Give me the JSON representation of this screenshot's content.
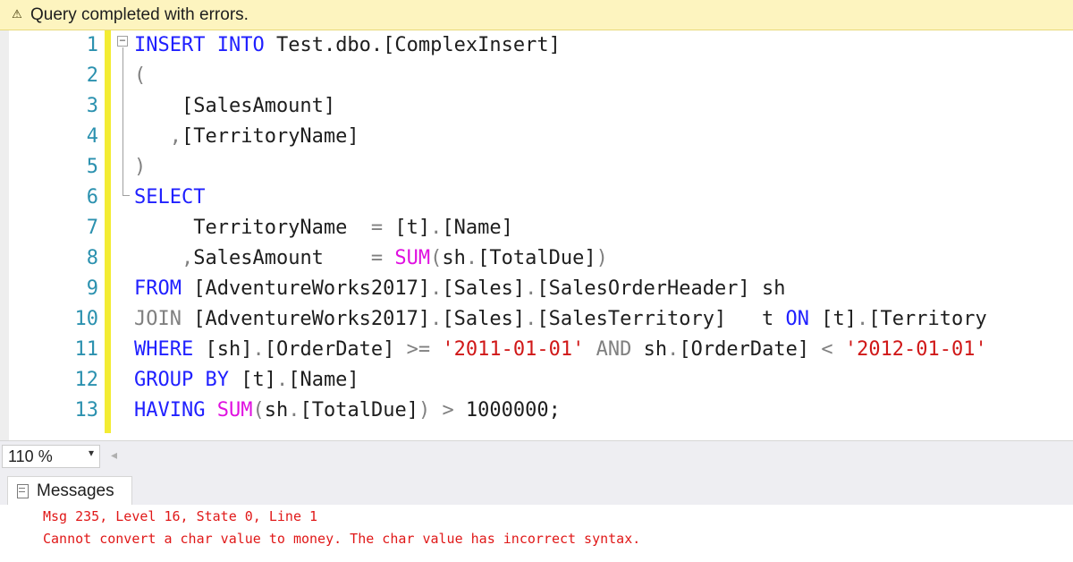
{
  "status_bar": {
    "text": "Query completed with errors."
  },
  "editor": {
    "line_numbers": [
      "1",
      "2",
      "3",
      "4",
      "5",
      "6",
      "7",
      "8",
      "9",
      "10",
      "11",
      "12",
      "13"
    ],
    "lines": [
      [
        [
          "kw",
          "INSERT"
        ],
        [
          "id",
          " "
        ],
        [
          "kw",
          "INTO"
        ],
        [
          "id",
          " Test.dbo.[ComplexInsert]"
        ]
      ],
      [
        [
          "op",
          "("
        ]
      ],
      [
        [
          "id",
          "    [SalesAmount]"
        ]
      ],
      [
        [
          "op",
          "   ,"
        ],
        [
          "id",
          "[TerritoryName]"
        ]
      ],
      [
        [
          "op",
          ")"
        ]
      ],
      [
        [
          "kw",
          "SELECT"
        ]
      ],
      [
        [
          "id",
          "     TerritoryName  "
        ],
        [
          "op",
          "="
        ],
        [
          "id",
          " [t]"
        ],
        [
          "op",
          "."
        ],
        [
          "id",
          "[Name]"
        ]
      ],
      [
        [
          "op",
          "    ,"
        ],
        [
          "id",
          "SalesAmount    "
        ],
        [
          "op",
          "="
        ],
        [
          "id",
          " "
        ],
        [
          "fn",
          "SUM"
        ],
        [
          "op",
          "("
        ],
        [
          "id",
          "sh"
        ],
        [
          "op",
          "."
        ],
        [
          "id",
          "[TotalDue]"
        ],
        [
          "op",
          ")"
        ]
      ],
      [
        [
          "kw",
          "FROM"
        ],
        [
          "id",
          " [AdventureWorks2017]"
        ],
        [
          "op",
          "."
        ],
        [
          "id",
          "[Sales]"
        ],
        [
          "op",
          "."
        ],
        [
          "id",
          "[SalesOrderHeader] sh"
        ]
      ],
      [
        [
          "op",
          "JOIN"
        ],
        [
          "id",
          " [AdventureWorks2017]"
        ],
        [
          "op",
          "."
        ],
        [
          "id",
          "[Sales]"
        ],
        [
          "op",
          "."
        ],
        [
          "id",
          "[SalesTerritory]   t "
        ],
        [
          "kw",
          "ON"
        ],
        [
          "id",
          " [t]"
        ],
        [
          "op",
          "."
        ],
        [
          "id",
          "[Territory"
        ]
      ],
      [
        [
          "kw",
          "WHERE"
        ],
        [
          "id",
          " [sh]"
        ],
        [
          "op",
          "."
        ],
        [
          "id",
          "[OrderDate] "
        ],
        [
          "op",
          ">="
        ],
        [
          "id",
          " "
        ],
        [
          "str",
          "'2011-01-01'"
        ],
        [
          "id",
          " "
        ],
        [
          "op",
          "AND"
        ],
        [
          "id",
          " sh"
        ],
        [
          "op",
          "."
        ],
        [
          "id",
          "[OrderDate] "
        ],
        [
          "op",
          "<"
        ],
        [
          "id",
          " "
        ],
        [
          "str",
          "'2012-01-01'"
        ]
      ],
      [
        [
          "kw",
          "GROUP BY"
        ],
        [
          "id",
          " [t]"
        ],
        [
          "op",
          "."
        ],
        [
          "id",
          "[Name]"
        ]
      ],
      [
        [
          "kw",
          "HAVING"
        ],
        [
          "id",
          " "
        ],
        [
          "fn",
          "SUM"
        ],
        [
          "op",
          "("
        ],
        [
          "id",
          "sh"
        ],
        [
          "op",
          "."
        ],
        [
          "id",
          "[TotalDue]"
        ],
        [
          "op",
          ")"
        ],
        [
          "id",
          " "
        ],
        [
          "op",
          ">"
        ],
        [
          "id",
          " 1000000;"
        ]
      ]
    ]
  },
  "zoom": {
    "value": "110 %",
    "arrow": "▾"
  },
  "results": {
    "tab_label": "Messages",
    "messages": [
      "Msg 235, Level 16, State 0, Line 1",
      "Cannot convert a char value to money. The char value has incorrect syntax."
    ]
  },
  "colors": {
    "keyword": "#2020ff",
    "function": "#e010e0",
    "string": "#d01818",
    "operator": "#808080",
    "line_number": "#2b91af",
    "error_text": "#e01818",
    "status_bar_bg": "#fdf4bf",
    "change_margin": "#f3ec33"
  },
  "icons": {
    "status": "warning-icon",
    "collapse": "collapse-minus-icon",
    "zoom_dropdown": "chevron-down-icon",
    "scroll_left": "scroll-left-arrow-icon",
    "messages_tab": "messages-icon"
  }
}
